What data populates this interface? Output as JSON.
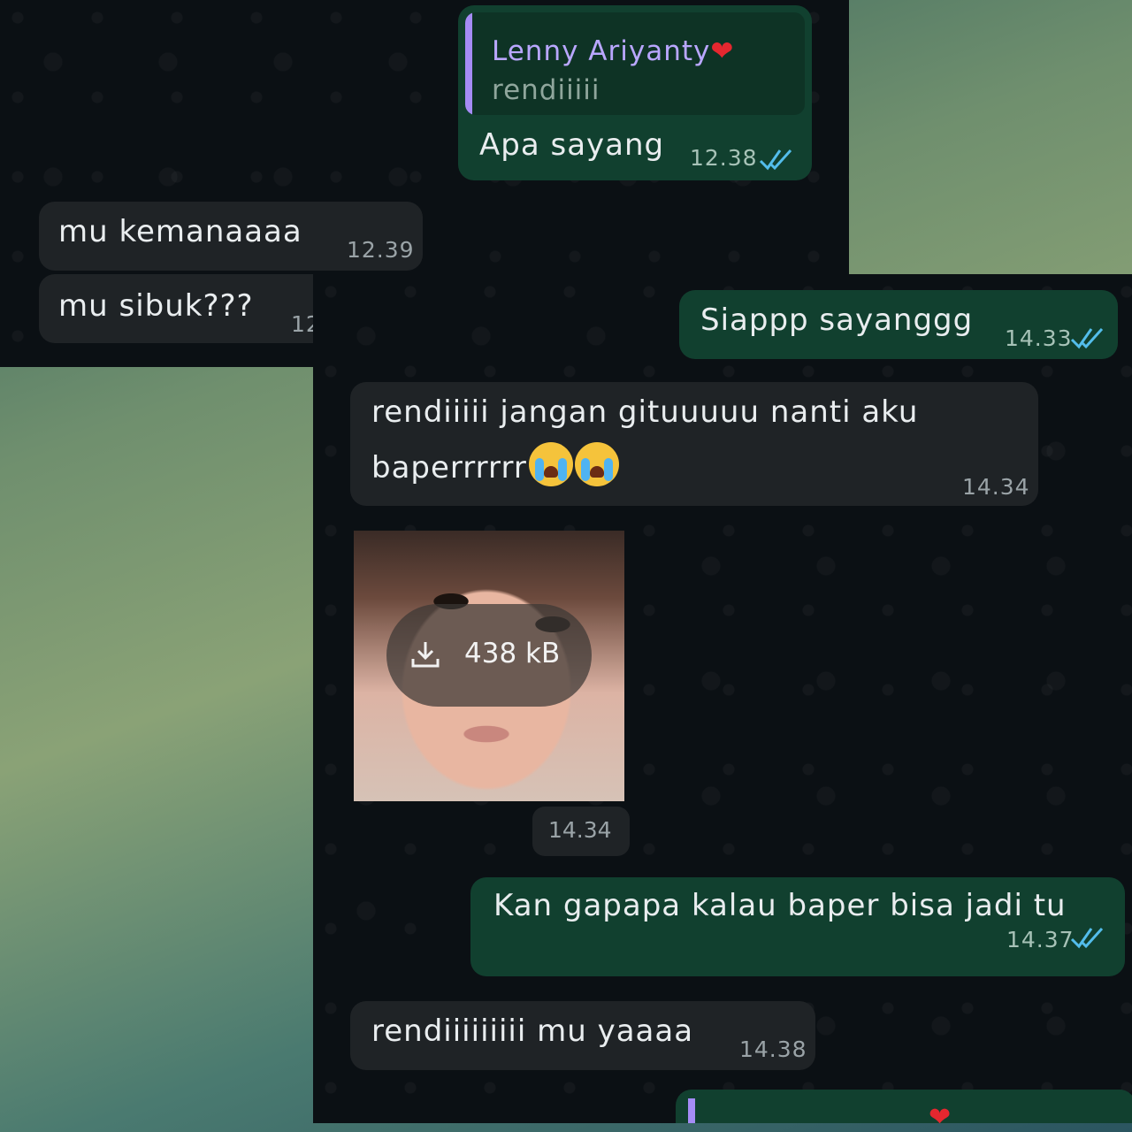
{
  "messages": {
    "m1": {
      "reply_name": "Lenny Ariyanty",
      "reply_heart": "❤",
      "reply_text": "rendiiiii",
      "text": "Apa sayang",
      "time": "12.38"
    },
    "m2": {
      "text": "mu kemanaaaa",
      "time": "12.39"
    },
    "m3": {
      "text": "mu sibuk???",
      "time": "12"
    },
    "m4": {
      "text": "Siappp sayanggg",
      "time": "14.33"
    },
    "m5": {
      "line1": "rendiiiii jangan gituuuuu nanti aku",
      "line2": "baperrrrrr",
      "time": "14.34"
    },
    "m6": {
      "file_size": "438 kB",
      "time": "14.34"
    },
    "m7": {
      "text": "Kan gapapa kalau baper bisa jadi tu",
      "time": "14.37"
    },
    "m8": {
      "text": "rendiiiiiiiii mu yaaaa",
      "time": "14.38"
    },
    "m9": {
      "reply_heart": "❤"
    }
  },
  "colors": {
    "incoming_bubble": "#1f2326",
    "outgoing_bubble": "#11402f",
    "read_ticks": "#53bdeb",
    "reply_accent": "#a58cf5"
  },
  "icons": [
    "double-check-icon",
    "download-icon",
    "loudly-crying-face-emoji"
  ]
}
